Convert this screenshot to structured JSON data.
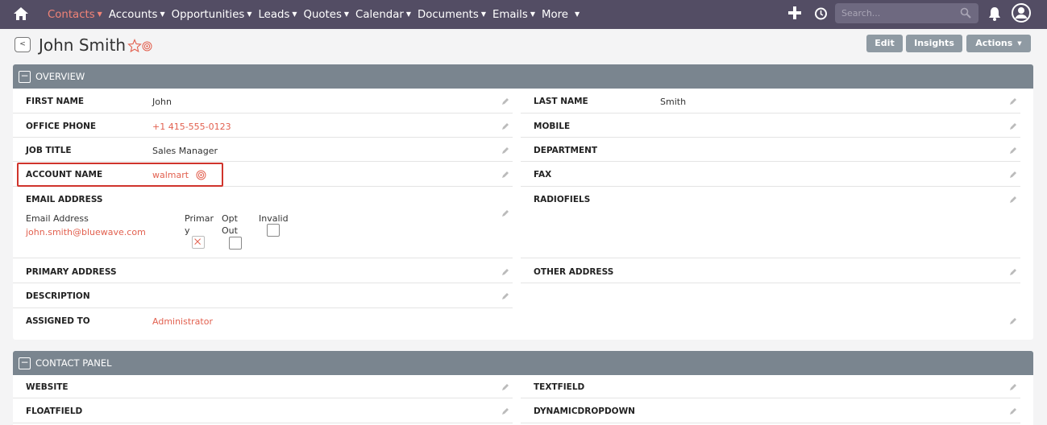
{
  "nav": {
    "items": [
      {
        "label": "Contacts",
        "active": true
      },
      {
        "label": "Accounts"
      },
      {
        "label": "Opportunities"
      },
      {
        "label": "Leads"
      },
      {
        "label": "Quotes"
      },
      {
        "label": "Calendar"
      },
      {
        "label": "Documents"
      },
      {
        "label": "Emails"
      },
      {
        "label": "More"
      }
    ],
    "search_placeholder": "Search...",
    "accent": "#f08377",
    "bar_color": "#534d64"
  },
  "header": {
    "title": "John Smith",
    "edit_label": "Edit",
    "insights_label": "Insights",
    "actions_label": "Actions"
  },
  "overview": {
    "title": "OVERVIEW",
    "first_name_label": "FIRST NAME",
    "first_name": "John",
    "last_name_label": "LAST NAME",
    "last_name": "Smith",
    "office_phone_label": "OFFICE PHONE",
    "office_phone": "+1 415-555-0123",
    "mobile_label": "MOBILE",
    "job_title_label": "JOB TITLE",
    "job_title": "Sales Manager",
    "department_label": "DEPARTMENT",
    "account_name_label": "ACCOUNT NAME",
    "account_name": "walmart",
    "fax_label": "FAX",
    "email_address_label": "EMAIL ADDRESS",
    "email_sub_label": "Email Address",
    "email": "john.smith@bluewave.com",
    "primary_label_1": "Primar",
    "primary_label_2": "y",
    "opt_out_label_1": "Opt",
    "opt_out_label_2": "Out",
    "invalid_label": "Invalid",
    "radiofiels_label": "RADIOFIELS",
    "primary_address_label": "PRIMARY ADDRESS",
    "other_address_label": "OTHER ADDRESS",
    "description_label": "DESCRIPTION",
    "assigned_to_label": "ASSIGNED TO",
    "assigned_to": "Administrator"
  },
  "contact_panel": {
    "title": "CONTACT PANEL",
    "website_label": "WEBSITE",
    "textfield_label": "TEXTFIELD",
    "floatfield_label": "FLOATFIELD",
    "dynamicdropdown_label": "DYNAMICDROPDOWN"
  }
}
